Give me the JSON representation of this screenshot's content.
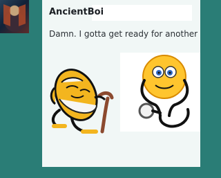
{
  "post": {
    "username": "AncientBoi",
    "message": "Damn. I gotta get ready for another",
    "avatar_icon": "superhero-avatar-icon"
  },
  "stickers": [
    {
      "name": "old-man-emoji-icon"
    },
    {
      "name": "doctor-smiley-stethoscope-icon"
    }
  ],
  "colors": {
    "page_bg": "#2a7d76",
    "card_bg": "#f1f7f6",
    "text": "#2a2f34",
    "username": "#1b1f24"
  }
}
